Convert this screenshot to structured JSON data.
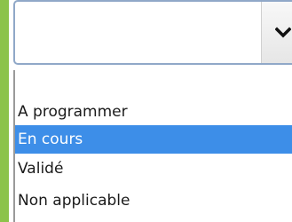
{
  "select": {
    "value": "",
    "icon": "chevron-down-icon"
  },
  "dropdown": {
    "options": [
      {
        "label": "",
        "selected": false
      },
      {
        "label": "A programmer",
        "selected": false
      },
      {
        "label": "En cours",
        "selected": true
      },
      {
        "label": "Validé",
        "selected": false
      },
      {
        "label": "Non applicable",
        "selected": false
      }
    ]
  },
  "colors": {
    "accent": "#8cc34a",
    "select_border": "#90a8c8",
    "selected_bg": "#3d8ee8",
    "selected_text": "#ffffff",
    "text": "#1a1a1a"
  }
}
